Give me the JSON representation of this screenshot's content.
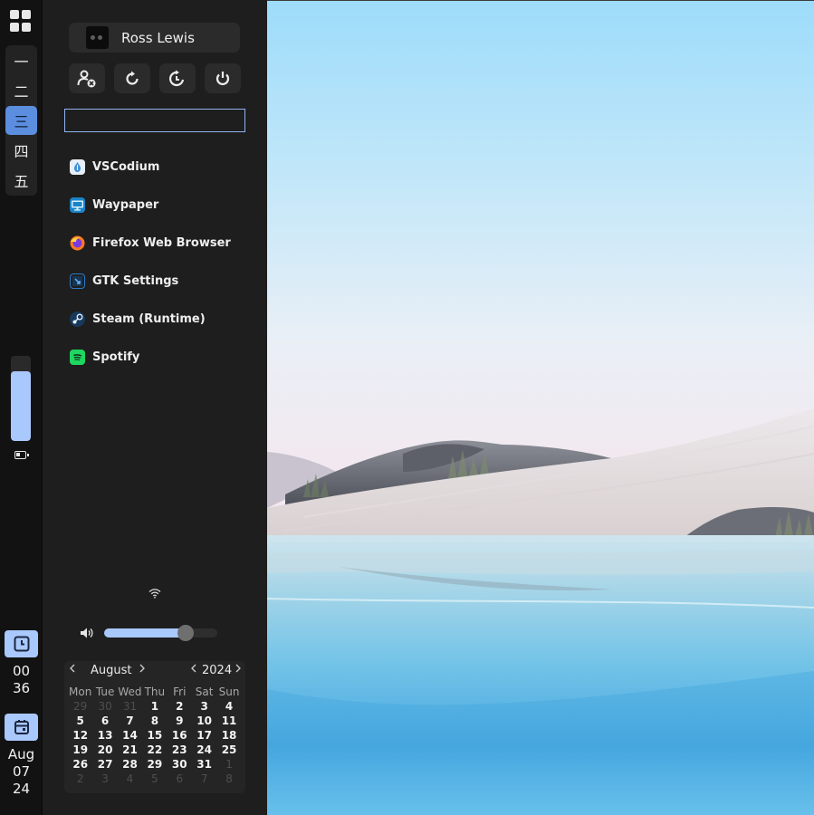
{
  "launcher": {
    "icon": "grid-icon"
  },
  "workspaces": [
    {
      "label": "一",
      "active": false
    },
    {
      "label": "二",
      "active": false
    },
    {
      "label": "三",
      "active": true
    },
    {
      "label": "四",
      "active": false
    },
    {
      "label": "五",
      "active": false
    }
  ],
  "brightness": {
    "level": 0.82
  },
  "battery": {
    "icon": "battery-icon"
  },
  "clock": {
    "icon": "clock-icon",
    "hour": "00",
    "minute": "36"
  },
  "date": {
    "icon": "calendar-icon",
    "month": "Aug",
    "day": "07",
    "year": "24"
  },
  "user": {
    "name": "Ross Lewis",
    "avatar": "avatar-icon"
  },
  "power_buttons": [
    {
      "icon": "logout-icon"
    },
    {
      "icon": "reboot-icon"
    },
    {
      "icon": "suspend-icon"
    },
    {
      "icon": "power-icon"
    }
  ],
  "search": {
    "value": "",
    "placeholder": ""
  },
  "apps": [
    {
      "label": "VSCodium",
      "icon": "vscodium-icon",
      "color": "#e8eef7"
    },
    {
      "label": "Waypaper",
      "icon": "waypaper-icon",
      "color": "#1a84c9"
    },
    {
      "label": "Firefox Web Browser",
      "icon": "firefox-icon",
      "color": "#ff7b1c"
    },
    {
      "label": "GTK Settings",
      "icon": "gtk-settings-icon",
      "color": "#2d7ac8"
    },
    {
      "label": "Steam (Runtime)",
      "icon": "steam-icon",
      "color": "#1a9fff"
    },
    {
      "label": "Spotify",
      "icon": "spotify-icon",
      "color": "#1ed760"
    }
  ],
  "network": {
    "icon": "wifi-icon"
  },
  "volume": {
    "icon": "volume-icon",
    "level": 0.72
  },
  "calendar": {
    "month": "August",
    "year": "2024",
    "weekdays": [
      "Mon",
      "Tue",
      "Wed",
      "Thu",
      "Fri",
      "Sat",
      "Sun"
    ],
    "weeks": [
      [
        {
          "d": "29",
          "o": true
        },
        {
          "d": "30",
          "o": true
        },
        {
          "d": "31",
          "o": true
        },
        {
          "d": "1",
          "o": false
        },
        {
          "d": "2",
          "o": false
        },
        {
          "d": "3",
          "o": false
        },
        {
          "d": "4",
          "o": false
        }
      ],
      [
        {
          "d": "5",
          "o": false
        },
        {
          "d": "6",
          "o": false
        },
        {
          "d": "7",
          "o": false
        },
        {
          "d": "8",
          "o": false
        },
        {
          "d": "9",
          "o": false
        },
        {
          "d": "10",
          "o": false
        },
        {
          "d": "11",
          "o": false
        }
      ],
      [
        {
          "d": "12",
          "o": false
        },
        {
          "d": "13",
          "o": false
        },
        {
          "d": "14",
          "o": false
        },
        {
          "d": "15",
          "o": false
        },
        {
          "d": "16",
          "o": false
        },
        {
          "d": "17",
          "o": false
        },
        {
          "d": "18",
          "o": false
        }
      ],
      [
        {
          "d": "19",
          "o": false
        },
        {
          "d": "20",
          "o": false
        },
        {
          "d": "21",
          "o": false
        },
        {
          "d": "22",
          "o": false
        },
        {
          "d": "23",
          "o": false
        },
        {
          "d": "24",
          "o": false
        },
        {
          "d": "25",
          "o": false
        }
      ],
      [
        {
          "d": "26",
          "o": false
        },
        {
          "d": "27",
          "o": false
        },
        {
          "d": "28",
          "o": false
        },
        {
          "d": "29",
          "o": false
        },
        {
          "d": "30",
          "o": false
        },
        {
          "d": "31",
          "o": false
        },
        {
          "d": "1",
          "o": true
        }
      ],
      [
        {
          "d": "2",
          "o": true
        },
        {
          "d": "3",
          "o": true
        },
        {
          "d": "4",
          "o": true
        },
        {
          "d": "5",
          "o": true
        },
        {
          "d": "6",
          "o": true
        },
        {
          "d": "7",
          "o": true
        },
        {
          "d": "8",
          "o": true
        }
      ]
    ]
  },
  "colors": {
    "accent": "#a9c8fb",
    "accent_strong": "#5c8ee0",
    "panel": "#1e1e1e",
    "bar": "#121212"
  }
}
